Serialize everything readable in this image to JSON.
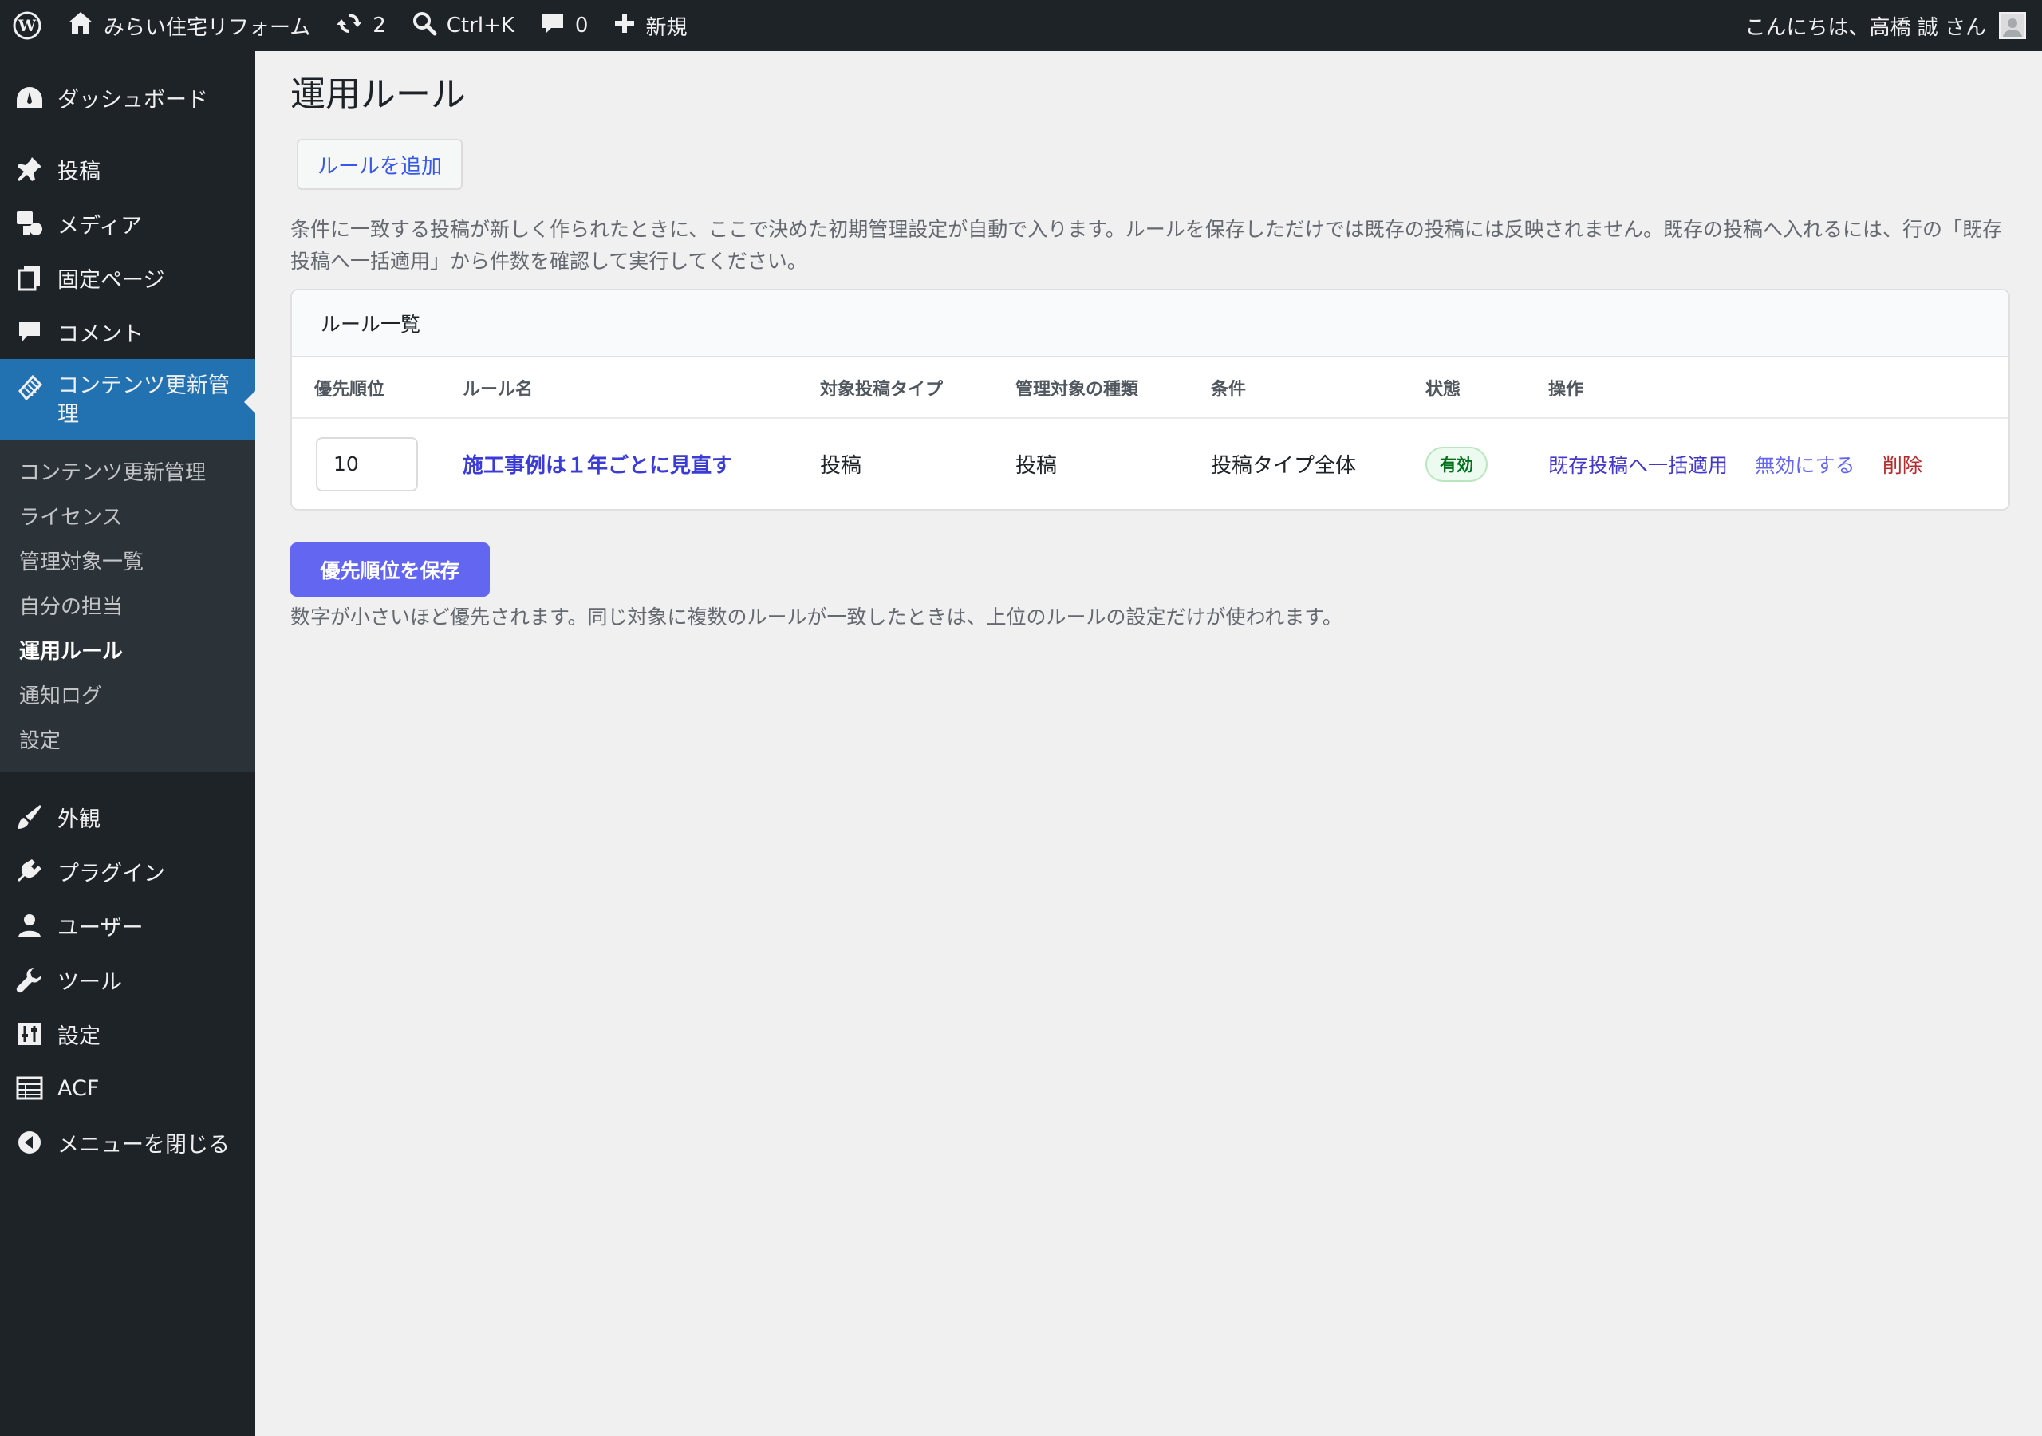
{
  "adminbar": {
    "site_name": "みらい住宅リフォーム",
    "updates_count": "2",
    "search_shortcut": "Ctrl+K",
    "comments_count": "0",
    "new_label": "新規",
    "greeting": "こんにちは、高橋 誠 さん"
  },
  "sidebar": {
    "dashboard": "ダッシュボード",
    "posts": "投稿",
    "media": "メディア",
    "pages": "固定ページ",
    "comments": "コメント",
    "current": "コンテンツ更新管理",
    "sub": [
      "コンテンツ更新管理",
      "ライセンス",
      "管理対象一覧",
      "自分の担当",
      "運用ルール",
      "通知ログ",
      "設定"
    ],
    "appearance": "外観",
    "plugins": "プラグイン",
    "users": "ユーザー",
    "tools": "ツール",
    "settings": "設定",
    "acf": "ACF",
    "collapse": "メニューを閉じる"
  },
  "main": {
    "title": "運用ルール",
    "add_rule": "ルールを追加",
    "description": "条件に一致する投稿が新しく作られたときに、ここで決めた初期管理設定が自動で入ります。ルールを保存しただけでは既存の投稿には反映されません。既存の投稿へ入れるには、行の「既存投稿へ一括適用」から件数を確認して実行してください。",
    "card_title": "ルール一覧",
    "columns": [
      "優先順位",
      "ルール名",
      "対象投稿タイプ",
      "管理対象の種類",
      "条件",
      "状態",
      "操作"
    ],
    "rows": [
      {
        "priority": "10",
        "name": "施工事例は１年ごとに見直す",
        "post_type": "投稿",
        "target_kind": "投稿",
        "condition": "投稿タイプ全体",
        "status": "有効",
        "action_apply": "既存投稿へ一括適用",
        "action_disable": "無効にする",
        "action_delete": "削除"
      }
    ],
    "save_button": "優先順位を保存",
    "note": "数字が小さいほど優先されます。同じ対象に複数のルールが一致したときは、上位のルールの設定だけが使われます。"
  },
  "colors": {
    "accent": "#2271b1",
    "primary_button": "#6366f1",
    "link": "#3b3bd6",
    "delete": "#b32d2e"
  }
}
